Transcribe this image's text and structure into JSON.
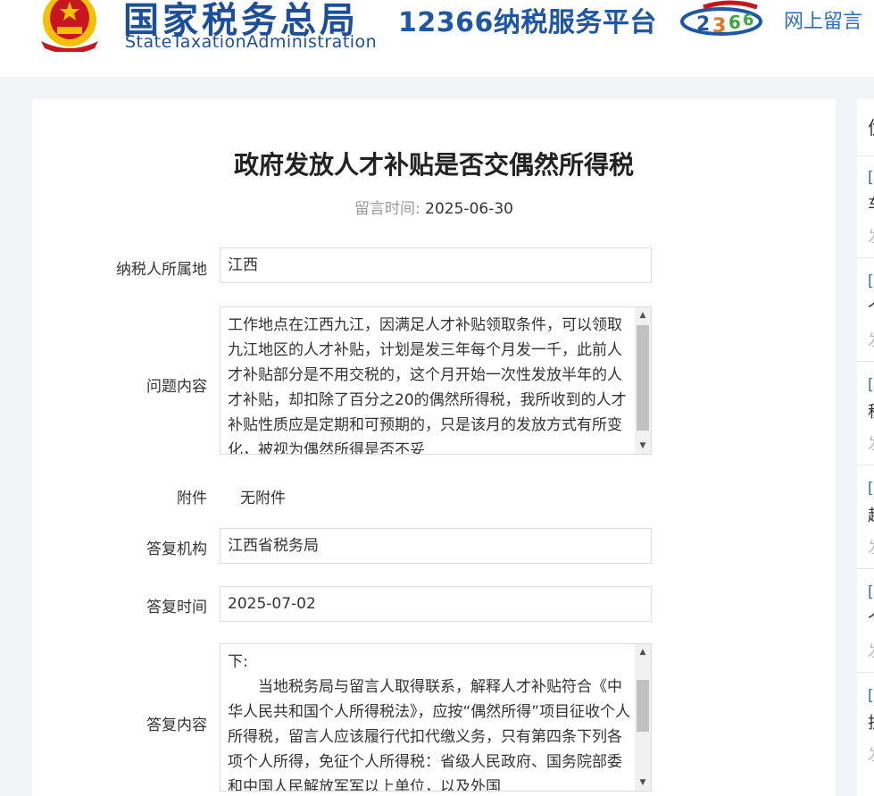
{
  "header": {
    "site_name_cn": "国家税务总局",
    "site_name_en": "StateTaxationAdministration",
    "platform_name": "12366纳税服务平台",
    "nav_link": "网上留言",
    "colors": {
      "brand_blue": "#1b4f9c",
      "link_blue": "#2b6cc4",
      "emblem_red": "#c8161d",
      "emblem_gold": "#f2c200"
    }
  },
  "question": {
    "title": "政府发放人才补贴是否交偶然所得税",
    "post_time_label": "留言时间:",
    "post_time": "2025-06-30",
    "taxpayer_location_label": "纳税人所属地",
    "taxpayer_location": "江西",
    "content_label": "问题内容",
    "content": "工作地点在江西九江，因满足人才补贴领取条件，可以领取九江地区的人才补贴，计划是发三年每个月发一千，此前人才补贴部分是不用交税的，这个月开始一次性发放半年的人才补贴，却扣除了百分之20的偶然所得税，我所收到的人才补贴性质应是定期和可预期的，只是该月的发放方式有所变化，被视为偶然所得是否不妥",
    "attachment_label": "附件",
    "attachment": "无附件"
  },
  "answer": {
    "org_label": "答复机构",
    "org": "江西省税务局",
    "time_label": "答复时间",
    "time": "2025-07-02",
    "content_label": "答复内容",
    "content_lines": [
      "下:",
      "当地税务局与留言人取得联系，解释人才补贴符合《中华人民共和国个人所得税法》，应按“偶然所得”项目征收个人所得税，留言人应该履行代扣代缴义务，只有第四条下列各项个人所得，免征个人所得税：省级人民政府、国务院部委和中国人民解放军军以上单位，以及外国"
    ]
  },
  "sidebar": {
    "heading": "优",
    "items": [
      {
        "bracket": "[",
        "char": "车",
        "date": "发"
      },
      {
        "bracket": "[",
        "char": "个",
        "date": "发"
      },
      {
        "bracket": "[",
        "char": "税",
        "date": "发"
      },
      {
        "bracket": "[",
        "char": "超",
        "date": "发"
      },
      {
        "bracket": "[",
        "char": "个",
        "date": "发"
      },
      {
        "bracket": "[",
        "char": "护",
        "date": "发"
      }
    ]
  }
}
